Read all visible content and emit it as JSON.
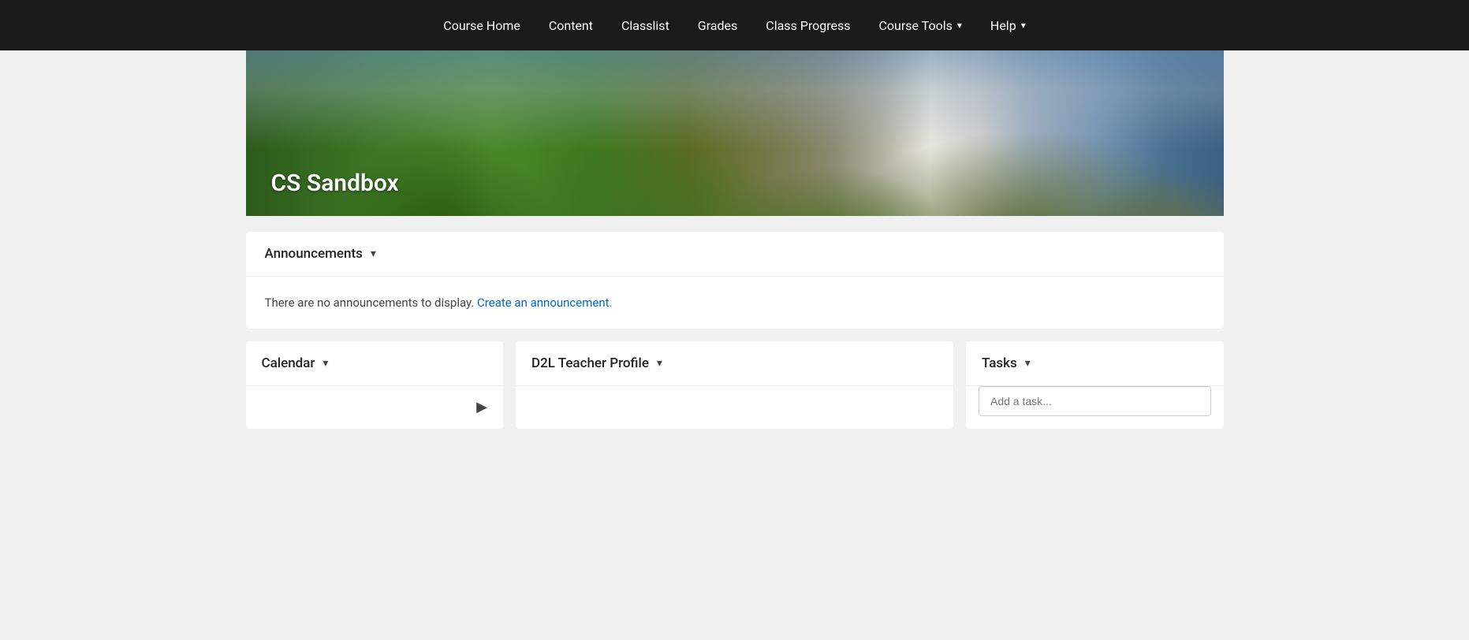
{
  "nav": {
    "items": [
      {
        "label": "Course Home",
        "hasDropdown": false
      },
      {
        "label": "Content",
        "hasDropdown": false
      },
      {
        "label": "Classlist",
        "hasDropdown": false
      },
      {
        "label": "Grades",
        "hasDropdown": false
      },
      {
        "label": "Class Progress",
        "hasDropdown": false
      },
      {
        "label": "Course Tools",
        "hasDropdown": true
      },
      {
        "label": "Help",
        "hasDropdown": true
      }
    ]
  },
  "hero": {
    "course_title": "CS Sandbox"
  },
  "announcements": {
    "header_label": "Announcements",
    "empty_text": "There are no announcements to display.",
    "create_link_text": "Create an announcement."
  },
  "calendar": {
    "header_label": "Calendar"
  },
  "d2l_teacher_profile": {
    "header_label": "D2L Teacher Profile"
  },
  "tasks": {
    "header_label": "Tasks",
    "input_placeholder": "Add a task..."
  }
}
